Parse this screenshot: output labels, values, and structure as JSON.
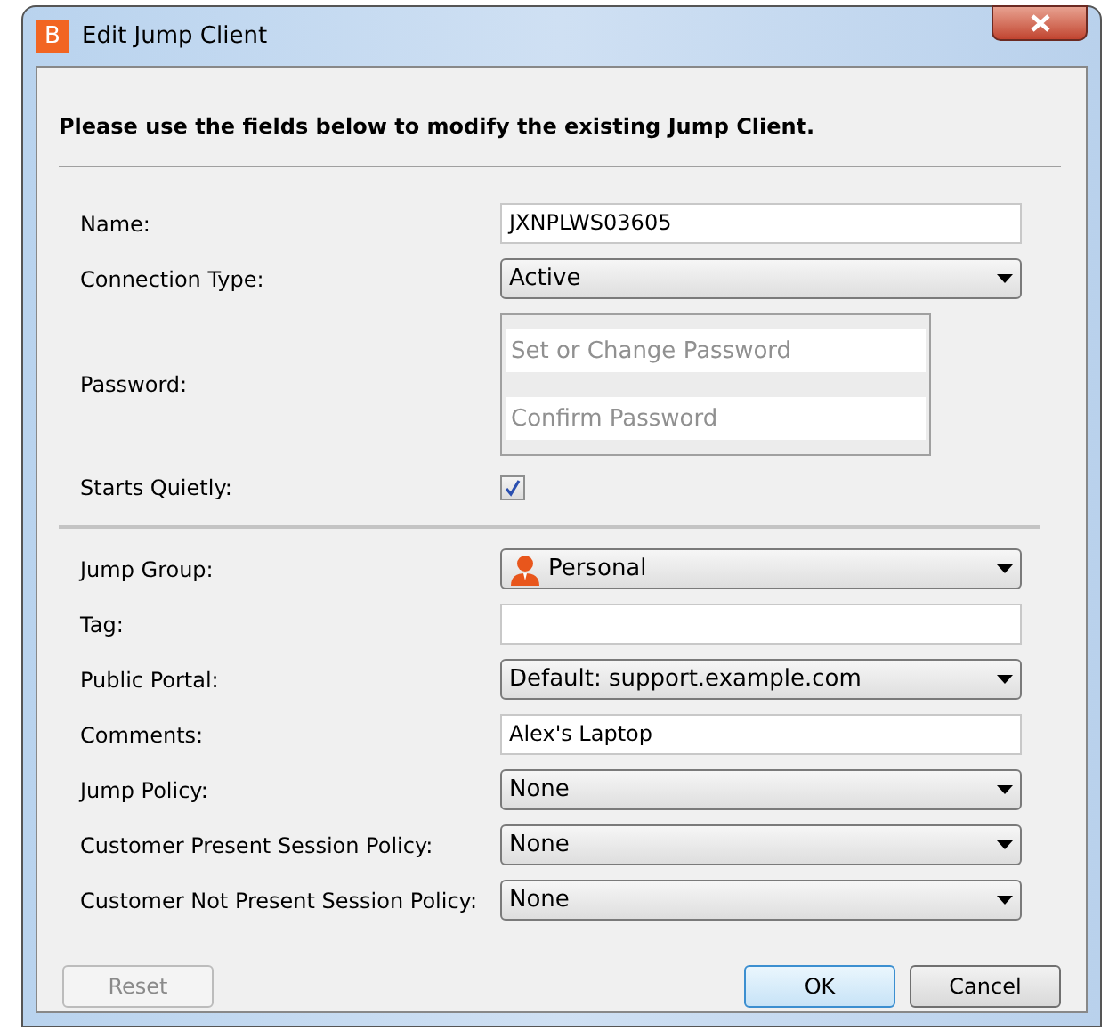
{
  "window": {
    "title": "Edit Jump Client",
    "logo": "B"
  },
  "instructions": "Please use the fields below to modify the existing Jump Client.",
  "sections": [
    [
      {
        "kind": "text",
        "label": "Name:",
        "value": "JXNPLWS03605"
      },
      {
        "kind": "select",
        "label": "Connection Type:",
        "value": "Active"
      },
      {
        "kind": "password",
        "label": "Password:",
        "placeholder": "Set or Change Password",
        "confirm_placeholder": "Confirm Password"
      },
      {
        "kind": "checkbox",
        "label": "Starts Quietly:",
        "checked": true
      }
    ],
    [
      {
        "kind": "select",
        "label": "Jump Group:",
        "value": "Personal",
        "icon": true
      },
      {
        "kind": "text",
        "label": "Tag:"
      },
      {
        "kind": "select",
        "label": "Public Portal:",
        "value": "Default: support.example.com"
      },
      {
        "kind": "text",
        "label": "Comments:",
        "value": "Alex's Laptop"
      },
      {
        "kind": "select",
        "label": "Jump Policy:",
        "value": "None"
      },
      {
        "kind": "select",
        "label": "Customer Present Session Policy:",
        "value": "None"
      },
      {
        "kind": "select",
        "label": "Customer Not Present Session Policy:",
        "value": "None"
      }
    ]
  ],
  "buttons": [
    {
      "label": "Reset",
      "disabled": true,
      "default": false
    },
    {
      "label": "OK",
      "disabled": false,
      "default": true
    },
    {
      "label": "Cancel",
      "disabled": false,
      "default": false
    }
  ]
}
